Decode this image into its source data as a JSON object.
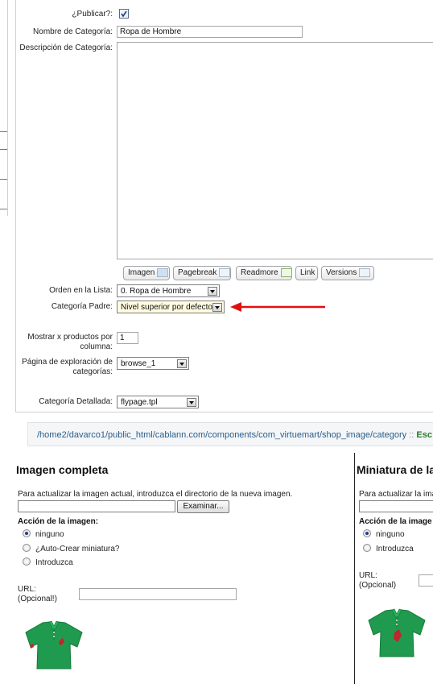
{
  "form": {
    "publish_label": "¿Publicar?:",
    "name_label": "Nombre de Categoría:",
    "name_value": "Ropa de Hombre",
    "description_label": "Descripción de Categoría:",
    "order_label": "Orden en la Lista:",
    "order_value": "0. Ropa de Hombre",
    "parent_label": "Categoría Padre:",
    "parent_value": "Nivel superior por defecto",
    "per_row_label_1": "Mostrar x productos por",
    "per_row_label_2": "columna:",
    "per_row_value": "1",
    "browse_label_1": "Página de exploración de",
    "browse_label_2": "categorías:",
    "browse_value": "browse_1",
    "flypage_label": "Categoría Detallada:",
    "flypage_value": "flypage.tpl"
  },
  "editor_buttons": {
    "image": "Imagen",
    "pagebreak": "Pagebreak",
    "readmore": "Readmore",
    "link": "Link",
    "versions": "Versions"
  },
  "path": {
    "text": "/home2/davarco1/public_html/cablann.com/components/com_virtuemart/shop_image/category",
    "sep": " :: ",
    "status": "Esc"
  },
  "full_image": {
    "title": "Imagen completa",
    "update_text": "Para actualizar la imagen actual, introduzca el directorio de la nueva imagen.",
    "browse_button": "Examinar...",
    "action_label": "Acción de la imagen:",
    "opt_none": "ninguno",
    "opt_auto": "¿Auto-Crear miniatura?",
    "opt_enter": "Introduzca",
    "url_label_1": "URL:",
    "url_label_2": "(Opcional!)"
  },
  "thumb_image": {
    "title": "Miniatura de la",
    "update_text": "Para actualizar la imag",
    "action_label": "Acción de la image",
    "opt_none": "ninguno",
    "opt_enter": "Introduzca",
    "url_label_1": "URL:",
    "url_label_2": "(Opcional)"
  },
  "colors": {
    "shirt": "#1f9a4e",
    "arrow": "#e01010",
    "path_text": "#2a5d8a",
    "status_text": "#2a7a2a"
  }
}
